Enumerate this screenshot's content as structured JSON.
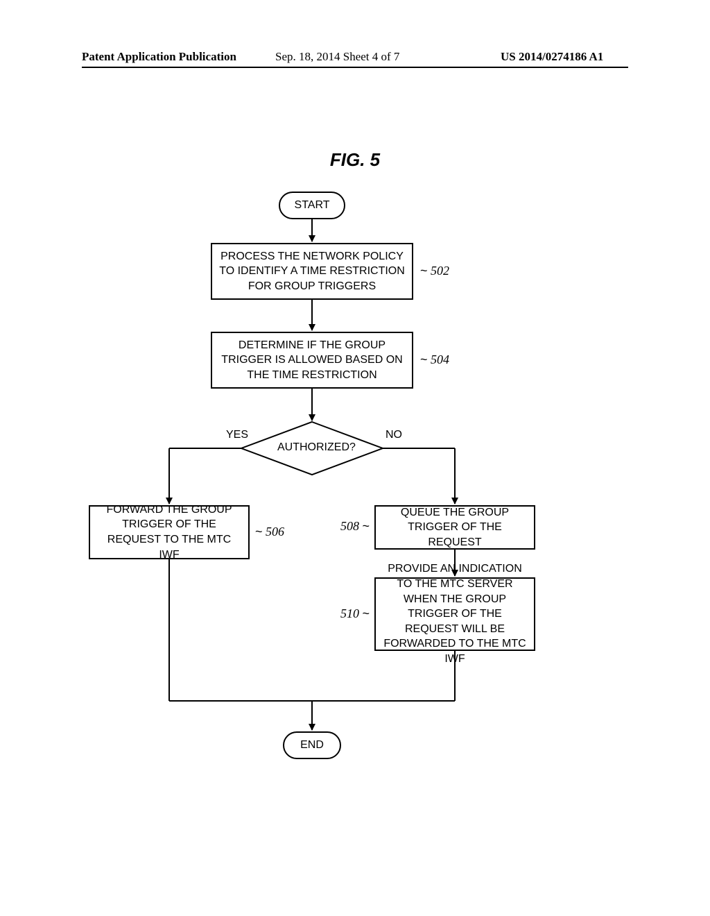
{
  "header": {
    "left": "Patent Application Publication",
    "center": "Sep. 18, 2014  Sheet 4 of 7",
    "right": "US 2014/0274186 A1"
  },
  "figure": {
    "title": "FIG. 5",
    "start": "START",
    "end": "END",
    "step502": "PROCESS THE NETWORK POLICY TO IDENTIFY A TIME RESTRICTION FOR GROUP TRIGGERS",
    "step504": "DETERMINE IF THE GROUP TRIGGER IS ALLOWED BASED ON THE TIME RESTRICTION",
    "decision": "AUTHORIZED?",
    "yes": "YES",
    "no": "NO",
    "step506": "FORWARD THE GROUP TRIGGER OF THE REQUEST TO THE MTC IWF",
    "step508": "QUEUE THE GROUP TRIGGER OF THE REQUEST",
    "step510": "PROVIDE AN INDICATION TO THE MTC SERVER WHEN THE GROUP TRIGGER OF THE REQUEST WILL BE FORWARDED TO THE MTC IWF",
    "ref502": "502",
    "ref504": "504",
    "ref506": "506",
    "ref508": "508",
    "ref510": "510"
  }
}
